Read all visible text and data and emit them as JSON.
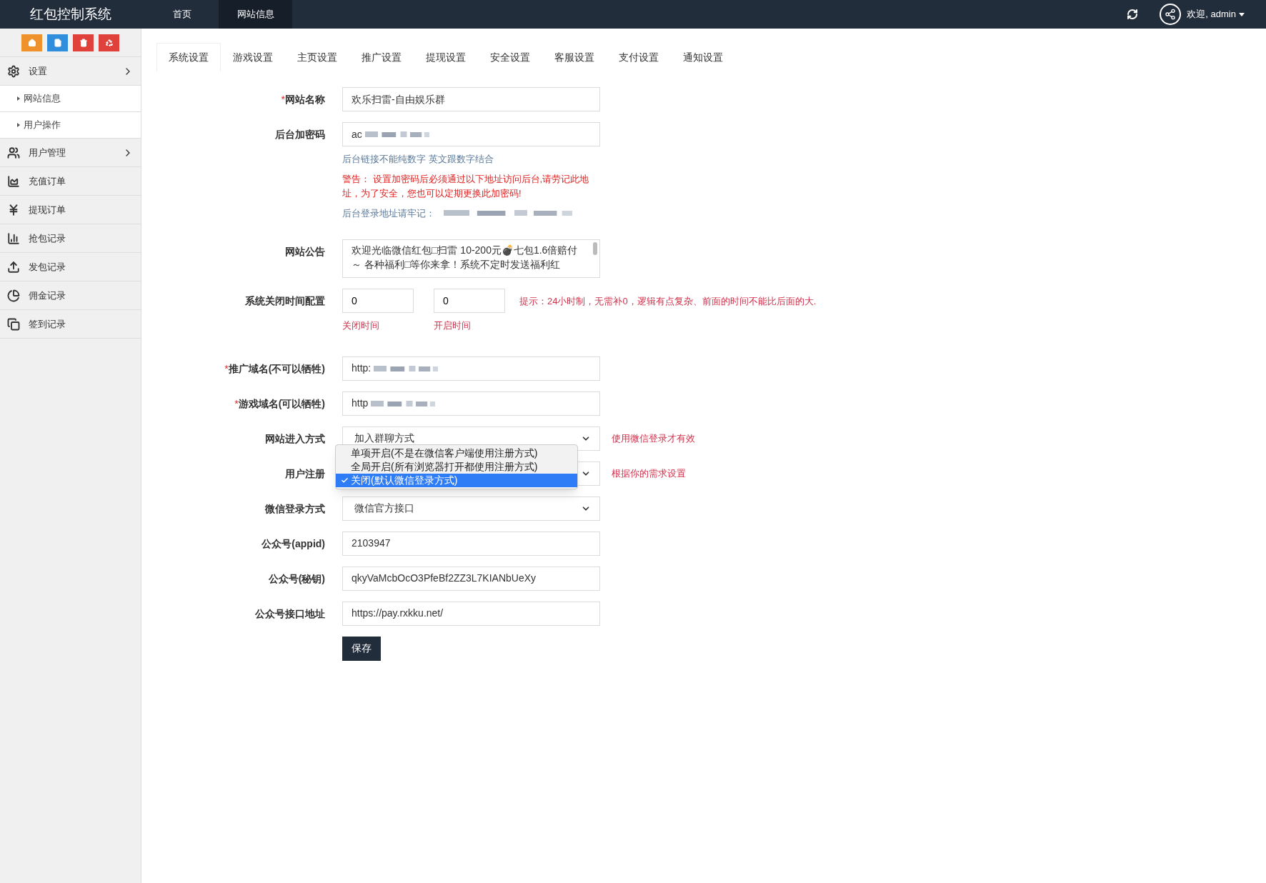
{
  "header": {
    "title": "红包控制系统",
    "nav": [
      {
        "label": "首页",
        "selected": false
      },
      {
        "label": "网站信息",
        "selected": true
      }
    ],
    "user": "欢迎, admin"
  },
  "sidebar": {
    "quick_buttons": [
      {
        "kind": "home",
        "color": "#f0922b"
      },
      {
        "kind": "file",
        "color": "#2f8fdc"
      },
      {
        "kind": "trash",
        "color": "#e0413a"
      },
      {
        "kind": "recycle",
        "color": "#e0413a"
      }
    ],
    "items": [
      {
        "kind": "gears",
        "label": "设置",
        "submenu": true,
        "children": [
          {
            "label": "网站信息"
          },
          {
            "label": "用户操作"
          }
        ]
      },
      {
        "kind": "users",
        "label": "用户管理",
        "submenu": true
      },
      {
        "kind": "area",
        "label": "充值订单"
      },
      {
        "kind": "yen",
        "label": "提现订单"
      },
      {
        "kind": "bars",
        "label": "抢包记录"
      },
      {
        "kind": "upload",
        "label": "发包记录"
      },
      {
        "kind": "pie",
        "label": "佣金记录"
      },
      {
        "kind": "windows",
        "label": "签到记录"
      }
    ]
  },
  "tabs": [
    {
      "label": "系统设置",
      "selected": true
    },
    {
      "label": "游戏设置",
      "selected": false
    },
    {
      "label": "主页设置",
      "selected": false
    },
    {
      "label": "推广设置",
      "selected": false
    },
    {
      "label": "提现设置",
      "selected": false
    },
    {
      "label": "安全设置",
      "selected": false
    },
    {
      "label": "客服设置",
      "selected": false
    },
    {
      "label": "支付设置",
      "selected": false
    },
    {
      "label": "通知设置",
      "selected": false
    }
  ],
  "form": [
    {
      "kind": "input",
      "label": "网站名称",
      "required_mark": "*",
      "value": "欢乐扫雷-自由娱乐群"
    },
    {
      "kind": "input",
      "label": "后台加密码",
      "value": "ac",
      "blurred": true,
      "notes": [
        {
          "kind": "hint",
          "text": "后台链接不能纯数字 英文跟数字结合"
        },
        {
          "kind": "warning",
          "text": "警告： 设置加密码后必须通过以下地址访问后台,请劳记此地址，为了安全，您也可以定期更换此加密码!"
        },
        {
          "kind": "hint",
          "text": "后台登录地址请牢记：",
          "blurred": true
        }
      ]
    },
    {
      "kind": "textarea",
      "label": "网站公告",
      "value": "欢迎光临微信红包□扫雷  10-200元💣七包1.6倍赔付～ 各种福利□等你来拿！系统不定时发送福利红"
    },
    {
      "kind": "time",
      "label": "系统关闭时间配置",
      "fields": [
        {
          "value": "0",
          "caption": "关闭时间"
        },
        {
          "value": "0",
          "caption": "开启时间"
        }
      ],
      "tip": "提示：24小时制，无需补0，逻辑有点复杂、前面的时间不能比后面的大."
    },
    {
      "kind": "input",
      "label": "推广域名(不可以牺牲)",
      "required_mark": "*",
      "value": "http:",
      "blurred": true
    },
    {
      "kind": "input",
      "label": "游戏域名(可以牺牲)",
      "required_mark": "*",
      "value": "http",
      "blurred": true
    },
    {
      "kind": "select",
      "label": "网站进入方式",
      "value": "加入群聊方式",
      "tip": "使用微信登录才有效"
    },
    {
      "kind": "select",
      "label": "用户注册",
      "open": true,
      "options": [
        {
          "label": "单项开启(不是在微信客户端使用注册方式)",
          "selected": false
        },
        {
          "label": "全局开启(所有浏览器打开都使用注册方式)",
          "selected": false
        },
        {
          "label": "关闭(默认微信登录方式)",
          "selected": true
        }
      ],
      "tip": "根据你的需求设置"
    },
    {
      "kind": "select",
      "label": "微信登录方式",
      "value": "微信官方接口"
    },
    {
      "kind": "input",
      "label": "公众号(appid)",
      "value": "2103947"
    },
    {
      "kind": "input",
      "label": "公众号(秘钥)",
      "value": "qkyVaMcbOcO3PfeBf2ZZ3L7KIANbUeXy"
    },
    {
      "kind": "input",
      "label": "公众号接口地址",
      "value": "https://pay.rxkku.net/"
    }
  ],
  "save_button": "保存"
}
